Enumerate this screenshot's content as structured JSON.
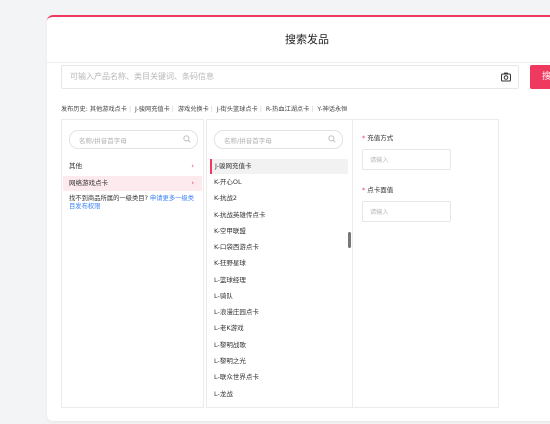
{
  "page": {
    "title": "搜索发品",
    "search": {
      "placeholder": "可输入产品名称、类目关键词、条码信息",
      "button": "搜"
    },
    "history": {
      "label": "发布历史:",
      "items": [
        "其他游戏点卡",
        "J-骏网充值卡",
        "游戏兑换卡",
        "J-街头篮球点卡",
        "R-热血江湖点卡",
        "Y-神话永恒"
      ]
    }
  },
  "categories": {
    "search_placeholder": "名称/拼音首字母",
    "items": [
      {
        "label": "其他",
        "selected": false
      },
      {
        "label": "网络游戏点卡",
        "selected": true
      }
    ],
    "note": "找不到商品所属的一级类目?",
    "note_link": "申请更多一级类目发布权限"
  },
  "subcategories": {
    "search_placeholder": "名称/拼音首字母",
    "items": [
      "J-骏网充值卡",
      "K-开心OL",
      "K-抗战2",
      "K-抗战英雄传点卡",
      "K-空甲联盟",
      "K-口袋西游点卡",
      "K-狂野星球",
      "L-篮球经理",
      "L-骑队",
      "L-浪漫庄园点卡",
      "L-老K游戏",
      "L-黎明战歌",
      "L-黎明之光",
      "L-联众世界点卡",
      "L-龙战"
    ],
    "selected_index": 0
  },
  "form": {
    "fields": [
      {
        "label": "充值方式",
        "placeholder": "请输入"
      },
      {
        "label": "点卡面值",
        "placeholder": "请输入"
      }
    ],
    "required_mark": "*"
  },
  "colors": {
    "accent": "#f0395e",
    "link": "#3b82f6"
  }
}
